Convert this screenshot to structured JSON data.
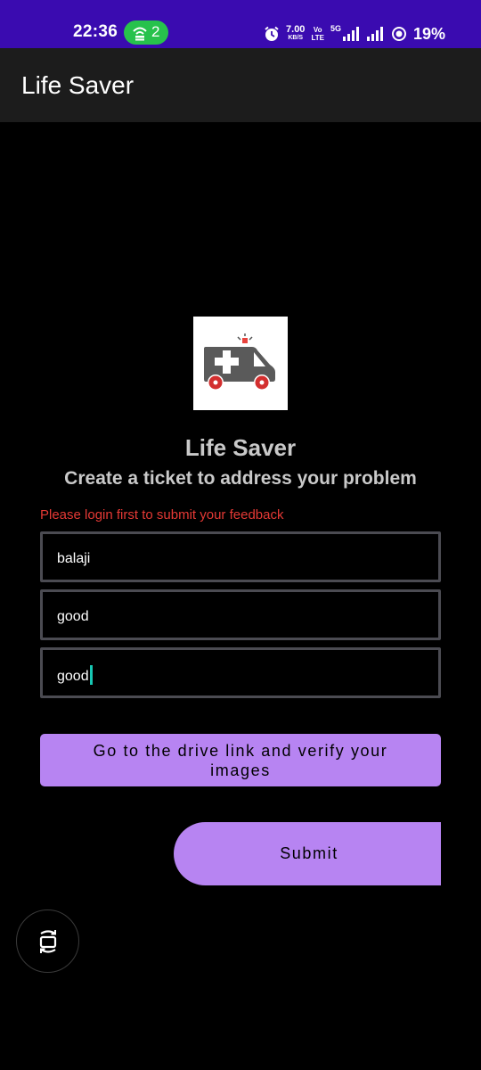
{
  "status_bar": {
    "time": "22:36",
    "hotspot_count": "2",
    "speed_value": "7.00",
    "speed_unit": "KB/S",
    "volte_top": "Vo",
    "volte_bottom": "LTE",
    "network": "5G",
    "battery": "19%",
    "background_color": "#3a0bb0"
  },
  "app_bar": {
    "title": "Life Saver"
  },
  "logo": {
    "icon": "ambulance-icon"
  },
  "content": {
    "heading": "Life Saver",
    "subheading": "Create a ticket to address your problem",
    "error_message": "Please login first to submit your feedback",
    "error_color": "#e53935"
  },
  "form": {
    "field1_value": "balaji",
    "field2_value": "good",
    "field3_value": "good"
  },
  "buttons": {
    "drive_link_label": "Go to the drive link and verify your images",
    "submit_label": "Submit",
    "accent_color": "#b784f2"
  },
  "floating": {
    "icon": "screen-rotate-icon"
  }
}
